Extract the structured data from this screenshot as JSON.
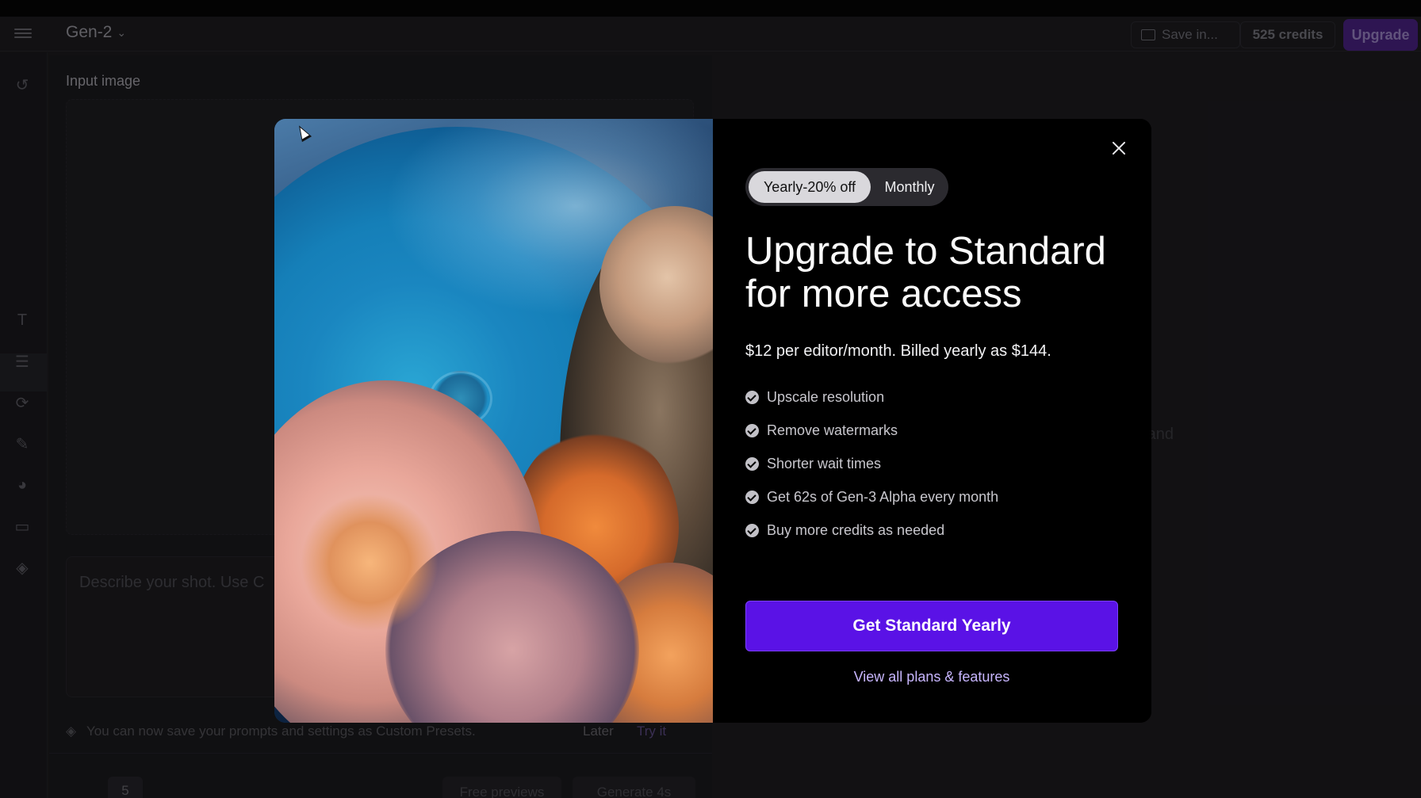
{
  "app": {
    "model_name": "Gen-2",
    "save_label": "Save in...",
    "credits_label": "525 credits",
    "upgrade_label": "Upgrade",
    "input_image_label": "Input image",
    "prompt_placeholder": "Describe your shot. Use C",
    "tip_text": "You can now save your prompts and settings as Custom Presets.",
    "tip_later": "Later",
    "tip_try": "Try it",
    "duration_value": "5",
    "free_previews_label": "Free previews",
    "generate_label": "Generate 4s",
    "right_hint": "e and"
  },
  "modal": {
    "billing_toggle": {
      "yearly_label": "Yearly-20% off",
      "monthly_label": "Monthly",
      "selected": "yearly"
    },
    "headline_line1": "Upgrade to Standard",
    "headline_line2": "for more access",
    "price_text": "$12 per editor/month. Billed yearly as $144.",
    "features": [
      "Upscale resolution",
      "Remove watermarks",
      "Shorter wait times",
      "Get 62s of Gen-3 Alpha every month",
      "Buy more credits as needed"
    ],
    "cta_label": "Get Standard Yearly",
    "view_plans_label": "View all plans & features",
    "colors": {
      "cta_background": "#5a12e6",
      "link": "#c8b6ff",
      "upgrade_accent": "#4b2385"
    }
  },
  "icons": {
    "menu": "hamburger-icon",
    "model_dropdown": "chevron-down-icon",
    "save": "folder-icon",
    "close": "close-icon",
    "feature_bullet": "check-circle-icon"
  }
}
